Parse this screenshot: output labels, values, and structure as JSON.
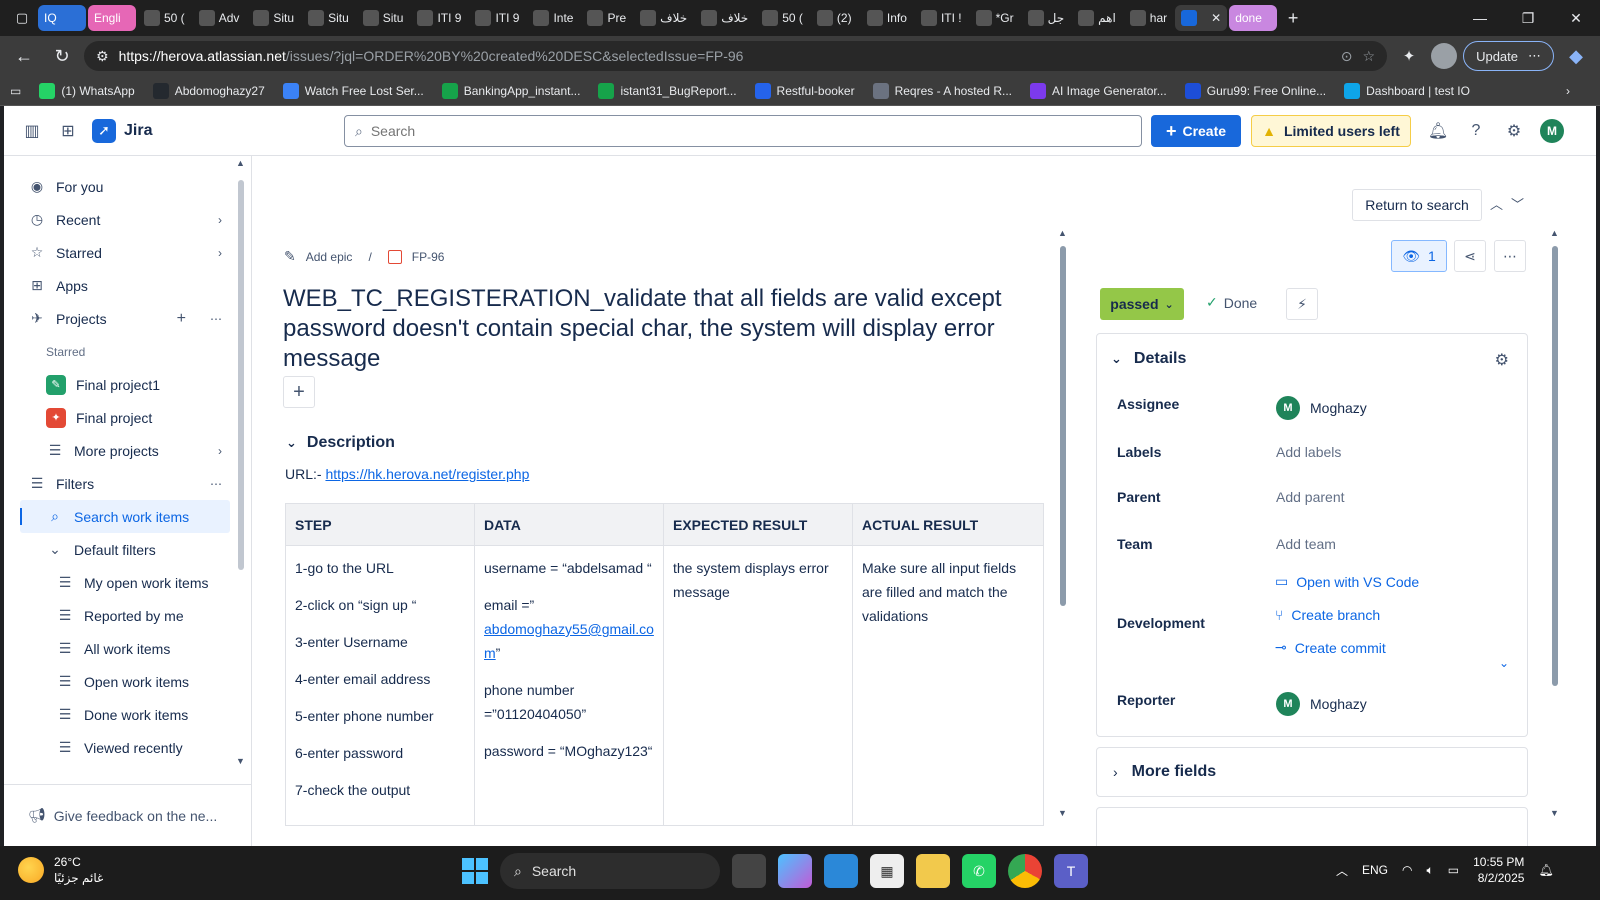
{
  "browser": {
    "tabs": [
      {
        "label": "IQ",
        "style": "iq"
      },
      {
        "label": "Engli",
        "style": "pill"
      },
      {
        "label": "50 (",
        "style": ""
      },
      {
        "label": "Adv",
        "style": ""
      },
      {
        "label": "Situ",
        "style": ""
      },
      {
        "label": "Situ",
        "style": ""
      },
      {
        "label": "Situ",
        "style": ""
      },
      {
        "label": "ITI 9",
        "style": ""
      },
      {
        "label": "ITI 9",
        "style": ""
      },
      {
        "label": "Inte",
        "style": ""
      },
      {
        "label": "Pre",
        "style": ""
      },
      {
        "label": "خلاف",
        "style": ""
      },
      {
        "label": "خلاف",
        "style": ""
      },
      {
        "label": "50 (",
        "style": ""
      },
      {
        "label": "(2)",
        "style": ""
      },
      {
        "label": "Info",
        "style": ""
      },
      {
        "label": "ITI !",
        "style": ""
      },
      {
        "label": "*Gr",
        "style": ""
      },
      {
        "label": "جل",
        "style": ""
      },
      {
        "label": "اهم",
        "style": ""
      },
      {
        "label": "har",
        "style": ""
      },
      {
        "label": "",
        "style": "active"
      },
      {
        "label": "done",
        "style": "done"
      }
    ],
    "url_host": "https://herova.atlassian.net",
    "url_path": "/issues/?jql=ORDER%20BY%20created%20DESC&selectedIssue=FP-96",
    "update_label": "Update",
    "bookmarks": [
      {
        "label": "(1) WhatsApp",
        "color": "#25d366"
      },
      {
        "label": "Abdomoghazy27",
        "color": "#24292f"
      },
      {
        "label": "Watch Free Lost Ser...",
        "color": "#3b82f6"
      },
      {
        "label": "BankingApp_instant...",
        "color": "#16a34a"
      },
      {
        "label": "istant31_BugReport...",
        "color": "#16a34a"
      },
      {
        "label": "Restful-booker",
        "color": "#2563eb"
      },
      {
        "label": "Reqres - A hosted R...",
        "color": "#6b7280"
      },
      {
        "label": "AI Image Generator...",
        "color": "#7c3aed"
      },
      {
        "label": "Guru99: Free Online...",
        "color": "#1d4ed8"
      },
      {
        "label": "Dashboard | test IO",
        "color": "#0ea5e9"
      }
    ]
  },
  "jira": {
    "product": "Jira",
    "search_placeholder": "Search",
    "create_label": "Create",
    "limited_label": "Limited users left",
    "user_initial": "M"
  },
  "sidebar": {
    "for_you": "For you",
    "recent": "Recent",
    "starred": "Starred",
    "apps": "Apps",
    "projects": "Projects",
    "starred_header": "Starred",
    "project1": "Final project1",
    "project2": "Final project",
    "more_projects": "More projects",
    "filters": "Filters",
    "search_work_items": "Search work items",
    "default_filters": "Default filters",
    "filter_items": [
      "My open work items",
      "Reported by me",
      "All work items",
      "Open work items",
      "Done work items",
      "Viewed recently"
    ],
    "feedback": "Give feedback on the ne..."
  },
  "issue": {
    "return_label": "Return to search",
    "add_epic": "Add epic",
    "key": "FP-96",
    "title": "WEB_TC_REGISTERATION_validate that all fields are valid except password doesn't contain special char, the system will display error message",
    "description_label": "Description",
    "url_prefix": "URL:- ",
    "url_link": "https://hk.herova.net/register.php",
    "table": {
      "headers": [
        "STEP",
        "DATA",
        "EXPECTED RESULT",
        "ACTUAL RESULT"
      ],
      "steps": [
        "1-go to the URL",
        "2-click on “sign up “",
        "3-enter Username",
        "4-enter email address",
        "5-enter phone number",
        "6-enter password",
        "7-check the output"
      ],
      "data_username": "username = “abdelsamad “",
      "data_email_prefix": "email =”",
      "data_email_link": "abdomoghazy55@gmail.com",
      "data_email_suffix": "”",
      "data_phone": "phone number =”01120404050”",
      "data_password": "password = “MOghazy123“",
      "expected": "the system displays error message",
      "actual": "Make sure all input fields are filled and match the validations"
    }
  },
  "panel": {
    "watch_count": "1",
    "status": "passed",
    "done_label": "Done",
    "details_label": "Details",
    "assignee_label": "Assignee",
    "assignee": "Moghazy",
    "labels_label": "Labels",
    "labels_value": "Add labels",
    "parent_label": "Parent",
    "parent_value": "Add parent",
    "team_label": "Team",
    "team_value": "Add team",
    "development_label": "Development",
    "open_vscode": "Open with VS Code",
    "create_branch": "Create branch",
    "create_commit": "Create commit",
    "reporter_label": "Reporter",
    "reporter": "Moghazy",
    "more_fields": "More fields"
  },
  "taskbar": {
    "temp": "26°C",
    "weather_desc": "غائم جزئيًا",
    "search_label": "Search",
    "lang": "ENG",
    "time": "10:55 PM",
    "date": "8/2/2025"
  }
}
